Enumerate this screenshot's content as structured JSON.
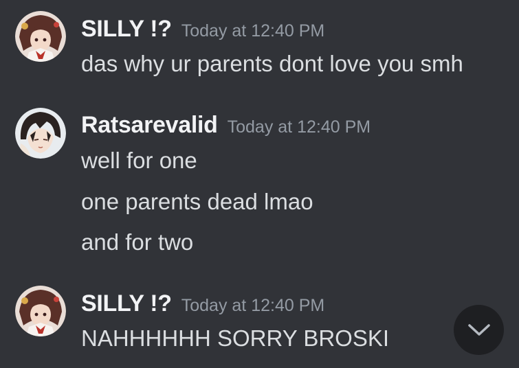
{
  "messages": [
    {
      "author": "SILLY !?",
      "timestamp": "Today at 12:40 PM",
      "avatar": "silly-avatar",
      "lines": [
        "das why ur parents dont love you smh"
      ]
    },
    {
      "author": "Ratsarevalid",
      "timestamp": "Today at 12:40 PM",
      "avatar": "ratsarevalid-avatar",
      "lines": [
        "well for one",
        "one parents dead lmao",
        "and for two"
      ]
    },
    {
      "author": "SILLY !?",
      "timestamp": "Today at 12:40 PM",
      "avatar": "silly-avatar",
      "lines": [
        "NAHHHHHH SORRY BROSKI"
      ]
    }
  ],
  "scroll_button": {
    "icon": "chevron-down-icon"
  },
  "colors": {
    "background": "#313338",
    "username": "#f2f3f5",
    "timestamp": "#949ba4",
    "message_text": "#dbdee1",
    "scroll_button_bg": "#1e1f22"
  }
}
